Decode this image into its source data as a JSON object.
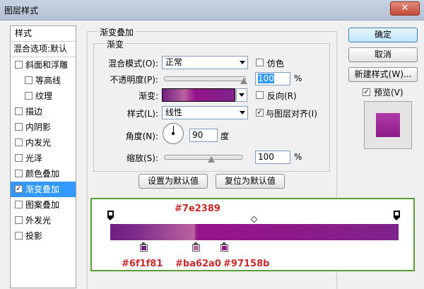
{
  "window": {
    "title": "图层样式",
    "close": "✕"
  },
  "style_list": {
    "header": "样式",
    "blend_options": "混合选项:默认",
    "items": [
      {
        "label": "斜面和浮雕",
        "checked": false
      },
      {
        "label": "等高线",
        "checked": false
      },
      {
        "label": "纹理",
        "checked": false
      },
      {
        "label": "描边",
        "checked": false
      },
      {
        "label": "内阴影",
        "checked": false
      },
      {
        "label": "内发光",
        "checked": false
      },
      {
        "label": "光泽",
        "checked": false
      },
      {
        "label": "颜色叠加",
        "checked": false
      },
      {
        "label": "渐变叠加",
        "checked": true
      },
      {
        "label": "图案叠加",
        "checked": false
      },
      {
        "label": "外发光",
        "checked": false
      },
      {
        "label": "投影",
        "checked": false
      }
    ]
  },
  "gradient_overlay": {
    "group_title": "渐变叠加",
    "sub_title": "渐变",
    "blend_mode_label": "混合模式(O):",
    "blend_mode_value": "正常",
    "dither_label": "仿色",
    "dither_checked": false,
    "opacity_label": "不透明度(P):",
    "opacity_value": "100",
    "opacity_unit": "%",
    "gradient_label": "渐变:",
    "reverse_label": "反向(R)",
    "reverse_checked": false,
    "style_label": "样式(L):",
    "style_value": "线性",
    "align_label": "与图层对齐(I)",
    "align_checked": true,
    "angle_label": "角度(N):",
    "angle_value": "90",
    "angle_unit": "度",
    "scale_label": "缩放(S):",
    "scale_value": "100",
    "scale_unit": "%",
    "make_default": "设置为默认值",
    "reset_default": "复位为默认值"
  },
  "right_panel": {
    "ok": "确定",
    "cancel": "取消",
    "new_style": "新建样式(W)...",
    "preview_label": "预览(V)",
    "preview_checked": true
  },
  "gradient_annotation": {
    "top_color": "#7e2389",
    "stops": [
      "#6f1f81",
      "#ba62a0",
      "#97158b"
    ]
  },
  "colors": {
    "selection": "#3399ff",
    "annotation_border": "#5a9e34",
    "annotation_text": "#cc2a2a"
  }
}
